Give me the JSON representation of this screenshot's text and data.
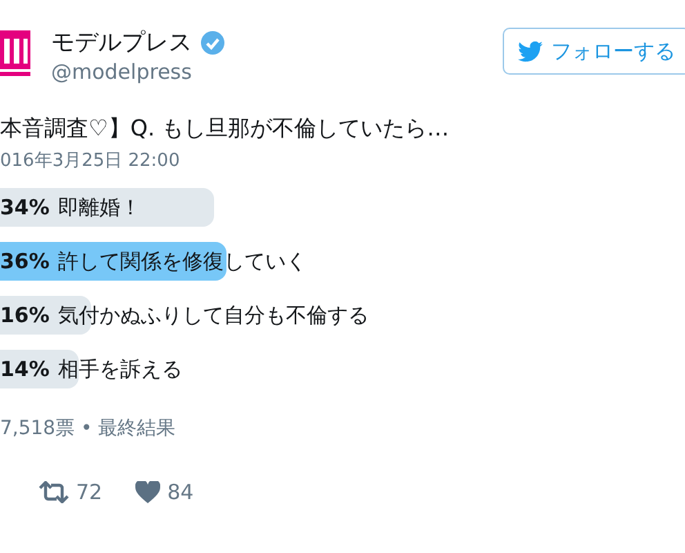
{
  "account": {
    "name": "モデルプレス",
    "handle": "@modelpress",
    "verified": true
  },
  "follow_button": {
    "label": "フォローする"
  },
  "tweet": {
    "text": "本音調査♡】Q. もし旦那が不倫していたら…",
    "date": "016年3月25日 22:00"
  },
  "poll": {
    "options": [
      {
        "percent": "34%",
        "label": "即離婚！",
        "selected": false
      },
      {
        "percent": "36%",
        "label": "許して関係を修復していく",
        "selected": true
      },
      {
        "percent": "16%",
        "label": "気付かぬふりして自分も不倫する",
        "selected": false
      },
      {
        "percent": "14%",
        "label": "相手を訴える",
        "selected": false
      }
    ],
    "summary": "7,518票 • 最終結果"
  },
  "actions": {
    "retweets": "72",
    "likes": "84"
  }
}
